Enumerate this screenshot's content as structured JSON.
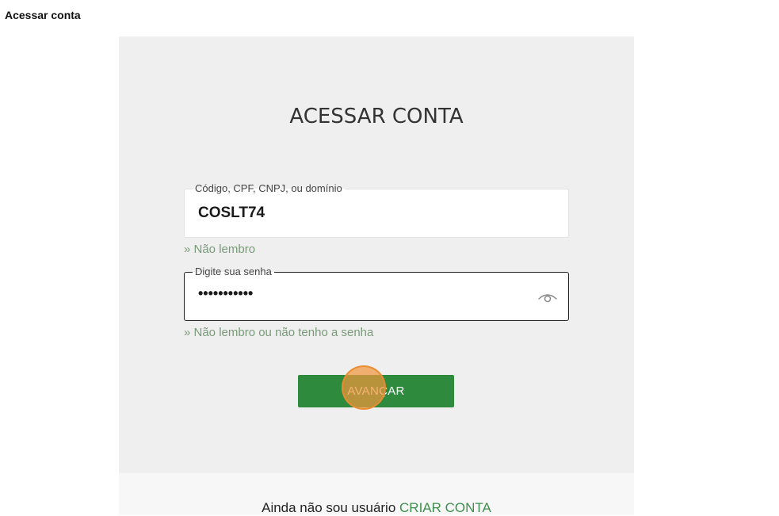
{
  "page": {
    "heading": "Acessar conta"
  },
  "login": {
    "title": "ACESSAR CONTA",
    "account_field": {
      "label": "Código, CPF, CNPJ, ou domínio",
      "value": "COSLT74"
    },
    "forgot_account_link": "» Não lembro",
    "password_field": {
      "label": "Digite sua senha",
      "value": "•••••••••••"
    },
    "forgot_password_link": "» Não lembro ou não tenho a senha",
    "submit_button": "AVANÇAR"
  },
  "footer": {
    "prompt": "Ainda não sou usuário",
    "create_account_link": "CRIAR CONTA"
  },
  "colors": {
    "button_green": "#2e8b3e",
    "link_green": "#3f8f4f",
    "card_background": "#efefef"
  },
  "icons": {
    "password_toggle": "eye-icon"
  }
}
